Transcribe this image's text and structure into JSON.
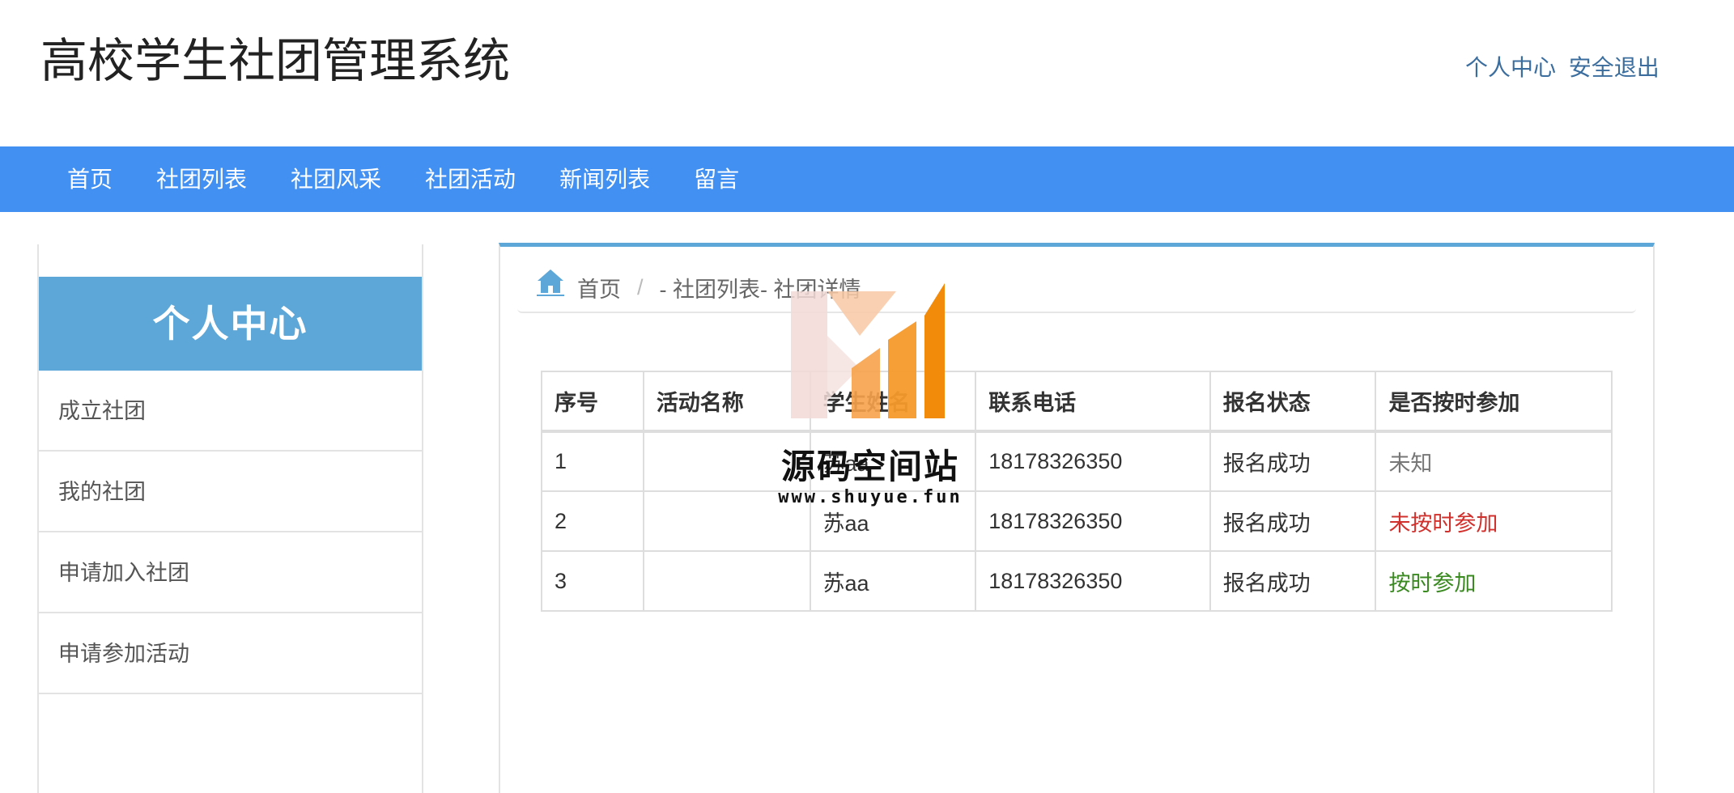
{
  "header": {
    "site_title": "高校学生社团管理系统",
    "links": [
      {
        "label": "个人中心"
      },
      {
        "label": "安全退出"
      }
    ]
  },
  "nav": {
    "items": [
      {
        "label": "首页"
      },
      {
        "label": "社团列表"
      },
      {
        "label": "社团风采"
      },
      {
        "label": "社团活动"
      },
      {
        "label": "新闻列表"
      },
      {
        "label": "留言"
      }
    ]
  },
  "sidebar": {
    "title": "个人中心",
    "items": [
      {
        "label": "成立社团"
      },
      {
        "label": "我的社团"
      },
      {
        "label": "申请加入社团"
      },
      {
        "label": "申请参加活动"
      }
    ]
  },
  "breadcrumb": {
    "home": "首页",
    "separator": "/",
    "path": "- 社团列表- 社团详情"
  },
  "table": {
    "headers": [
      "序号",
      "活动名称",
      "学生姓名",
      "联系电话",
      "报名状态",
      "是否按时参加"
    ],
    "rows": [
      {
        "no": "1",
        "activity": "",
        "student": "苏aa",
        "phone": "18178326350",
        "status": "报名成功",
        "attend": "未知"
      },
      {
        "no": "2",
        "activity": "",
        "student": "苏aa",
        "phone": "18178326350",
        "status": "报名成功",
        "attend": "未按时参加"
      },
      {
        "no": "3",
        "activity": "",
        "student": "苏aa",
        "phone": "18178326350",
        "status": "报名成功",
        "attend": "按时参加"
      }
    ]
  },
  "watermark": {
    "title": "源码空间站",
    "url": "www.shuyue.fun"
  },
  "colors": {
    "nav_bg": "#4190f2",
    "sidebar_head_bg": "#5ca7d8",
    "panel_accent": "#5ca7d8",
    "link": "#3b6e9e",
    "status_unknown": "#777777",
    "status_late": "#d0312d",
    "status_ontime": "#3a8a21",
    "watermark_orange": "#f28a0a"
  },
  "icons": {
    "breadcrumb_home": "home-icon"
  }
}
